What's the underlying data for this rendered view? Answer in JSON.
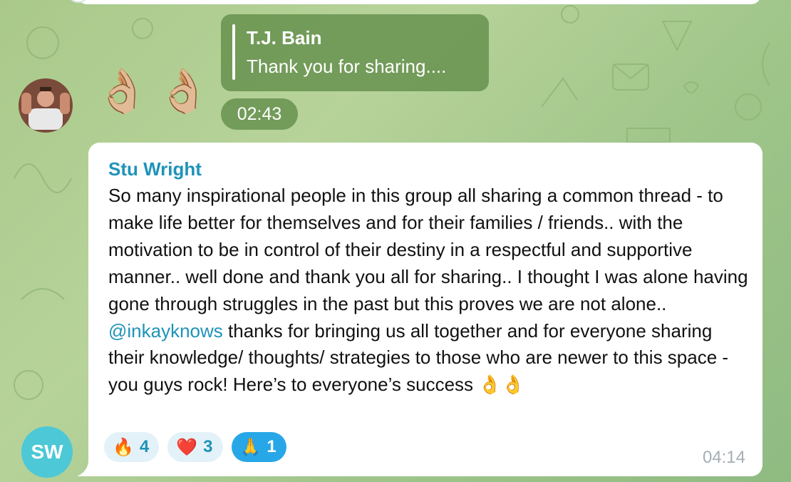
{
  "reply_preview": {
    "author": "T.J. Bain",
    "text": "Thank you for sharing...."
  },
  "sticker_message": {
    "emojis": [
      "👌🏼",
      "👌🏼"
    ],
    "time": "02:43"
  },
  "message": {
    "author": "Stu Wright",
    "text_before_mention": "So many inspirational people in this group all sharing a common thread - to make life better for themselves and for their families / friends.. with the motivation to be in control of their destiny in a respectful and supportive manner.. well done and thank you all for sharing.. I thought I was alone having gone through struggles in the past but this proves we are not alone.. ",
    "mention": "@inkayknows",
    "text_after_mention": " thanks for bringing us all together and for everyone sharing their knowledge/ thoughts/ strategies to those who are newer to this space - you guys rock! Here’s to everyone’s success ",
    "trailing_emojis": "👌👌",
    "time": "04:14",
    "reactions": [
      {
        "emoji": "🔥",
        "count": "4",
        "active": false
      },
      {
        "emoji": "❤️",
        "count": "3",
        "active": false
      },
      {
        "emoji": "🙏",
        "count": "1",
        "active": true
      }
    ]
  },
  "avatars": {
    "sender_initials": "SW"
  },
  "colors": {
    "background": "#a9c98a",
    "reply_bubble": "#608c48",
    "accent": "#1f93b8",
    "active_reaction": "#27a7e7",
    "avatar_sw": "#4cc8d6"
  }
}
